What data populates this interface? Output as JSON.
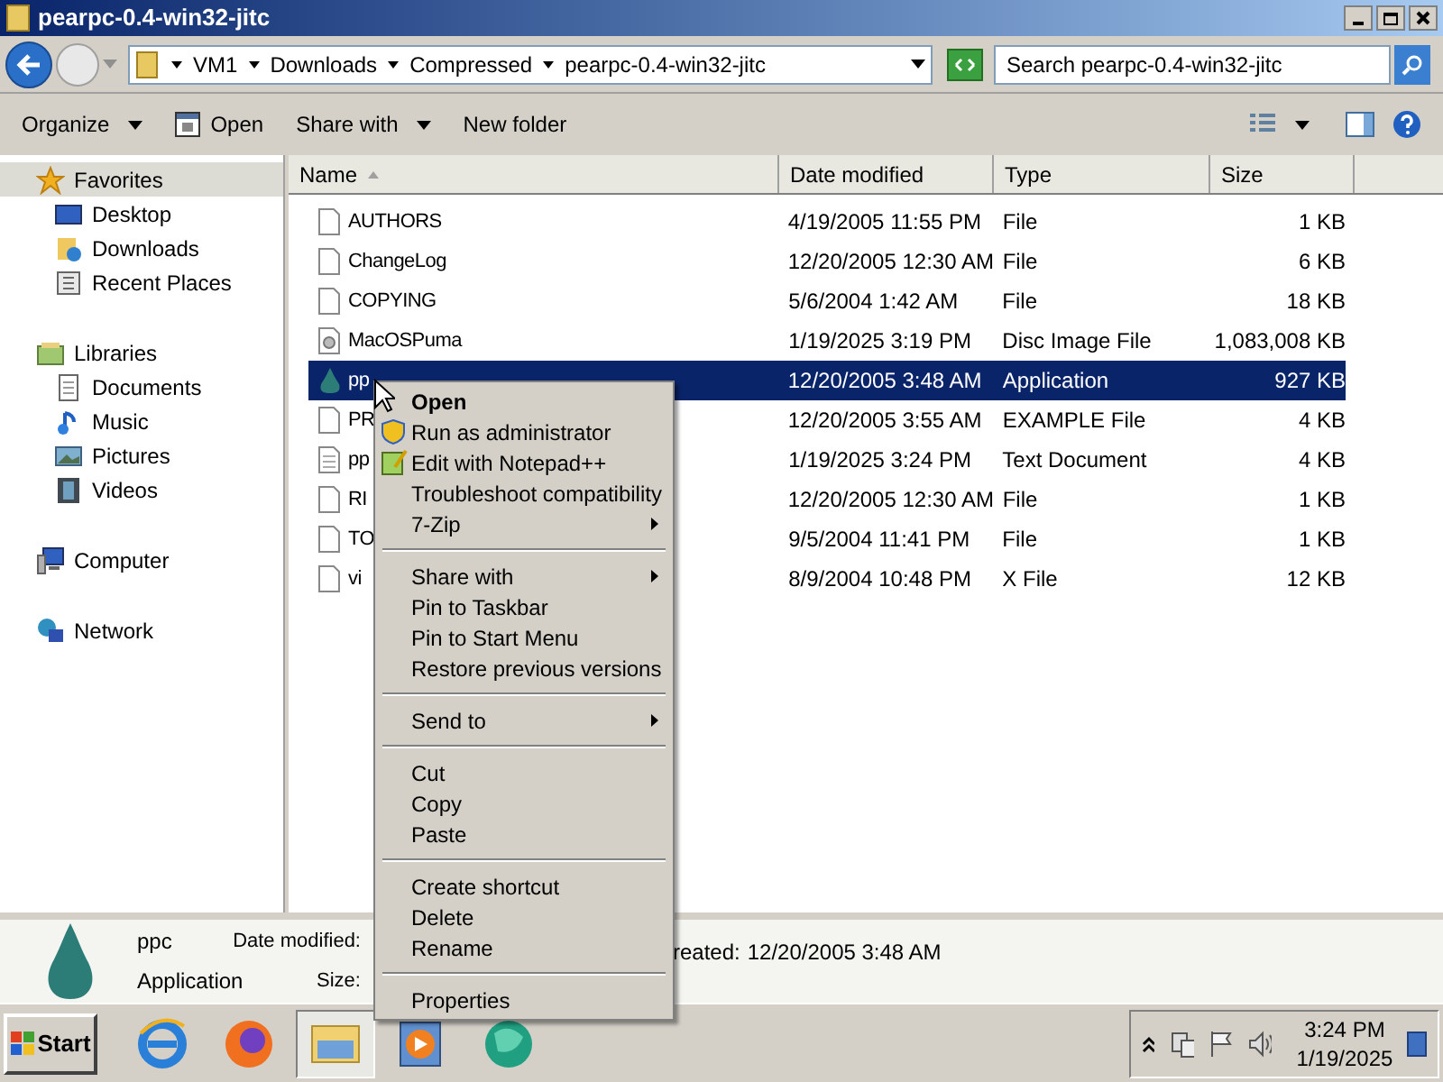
{
  "window": {
    "title": "pearpc-0.4-win32-jitc"
  },
  "address": {
    "breadcrumb": [
      "VM1",
      "Downloads",
      "Compressed",
      "pearpc-0.4-win32-jitc"
    ],
    "search_placeholder": "Search pearpc-0.4-win32-jitc"
  },
  "toolbar": [
    {
      "label": "Organize",
      "kind": "menu"
    },
    {
      "label": "Open",
      "kind": "open"
    },
    {
      "label": "Share with",
      "kind": "menu"
    },
    {
      "label": "New folder",
      "kind": "plain"
    }
  ],
  "sidebar": [
    {
      "label": "Favorites",
      "kind": "star",
      "selected": true,
      "children": [
        {
          "label": "Desktop",
          "kind": "desktop",
          "selected": false
        },
        {
          "label": "Downloads",
          "kind": "downloads",
          "selected": false
        },
        {
          "label": "Recent Places",
          "kind": "recent",
          "selected": false
        }
      ]
    },
    {
      "label": "Libraries",
      "kind": "library",
      "selected": false,
      "children": [
        {
          "label": "Documents",
          "kind": "documents",
          "selected": false
        },
        {
          "label": "Music",
          "kind": "music",
          "selected": false
        },
        {
          "label": "Pictures",
          "kind": "pictures",
          "selected": false
        },
        {
          "label": "Videos",
          "kind": "videos",
          "selected": false
        }
      ]
    },
    {
      "label": "Computer",
      "kind": "computer",
      "selected": false
    },
    {
      "label": "Network",
      "kind": "network",
      "selected": false
    }
  ],
  "table": {
    "columns": [
      "Name",
      "Date modified",
      "Type",
      "Size"
    ],
    "rows": [
      {
        "kind": "file",
        "name": "AUTHORS",
        "date": "4/19/2005 11:55 PM",
        "type": "File",
        "size": "1 KB",
        "selected": false
      },
      {
        "kind": "file",
        "name": "ChangeLog",
        "date": "12/20/2005 12:30 AM",
        "type": "File",
        "size": "6 KB",
        "selected": false
      },
      {
        "kind": "file",
        "name": "COPYING",
        "date": "5/6/2004 1:42 AM",
        "type": "File",
        "size": "18 KB",
        "selected": false
      },
      {
        "kind": "disc",
        "name": "MacOSPuma",
        "date": "1/19/2025 3:19 PM",
        "type": "Disc Image File",
        "size": "1,083,008 KB",
        "selected": false
      },
      {
        "kind": "app",
        "name": "pp",
        "date": "12/20/2005 3:48 AM",
        "type": "Application",
        "size": "927 KB",
        "selected": true
      },
      {
        "kind": "file",
        "name": "PR",
        "date": "12/20/2005 3:55 AM",
        "type": "EXAMPLE File",
        "size": "4 KB",
        "selected": false
      },
      {
        "kind": "text",
        "name": "pp",
        "date": "1/19/2025 3:24 PM",
        "type": "Text Document",
        "size": "4 KB",
        "selected": false
      },
      {
        "kind": "file",
        "name": "RI",
        "date": "12/20/2005 12:30 AM",
        "type": "File",
        "size": "1 KB",
        "selected": false
      },
      {
        "kind": "file",
        "name": "TO",
        "date": "9/5/2004 11:41 PM",
        "type": "File",
        "size": "1 KB",
        "selected": false
      },
      {
        "kind": "file",
        "name": "vi",
        "date": "8/9/2004 10:48 PM",
        "type": "X File",
        "size": "12 KB",
        "selected": false
      }
    ]
  },
  "context_menu": [
    {
      "kind": "default",
      "label": "Open"
    },
    {
      "kind": "shield",
      "label": "Run as administrator"
    },
    {
      "kind": "notepad",
      "label": "Edit with Notepad++"
    },
    {
      "kind": "item",
      "label": "Troubleshoot compatibility"
    },
    {
      "kind": "submenu",
      "label": "7-Zip"
    },
    {
      "kind": "separator"
    },
    {
      "kind": "submenu",
      "label": "Share with"
    },
    {
      "kind": "item",
      "label": "Pin to Taskbar"
    },
    {
      "kind": "item",
      "label": "Pin to Start Menu"
    },
    {
      "kind": "item",
      "label": "Restore previous versions"
    },
    {
      "kind": "separator"
    },
    {
      "kind": "submenu",
      "label": "Send to"
    },
    {
      "kind": "separator"
    },
    {
      "kind": "item",
      "label": "Cut"
    },
    {
      "kind": "item",
      "label": "Copy"
    },
    {
      "kind": "item",
      "label": "Paste"
    },
    {
      "kind": "separator"
    },
    {
      "kind": "item",
      "label": "Create shortcut"
    },
    {
      "kind": "item",
      "label": "Delete"
    },
    {
      "kind": "item",
      "label": "Rename"
    },
    {
      "kind": "separator"
    },
    {
      "kind": "item",
      "label": "Properties"
    }
  ],
  "details": {
    "name": "ppc",
    "type": "Application",
    "date_label": "Date modified:",
    "size_label": "Size:",
    "created_label": "reated:",
    "created_value": "12/20/2005 3:48 AM"
  },
  "taskbar": {
    "start": "Start",
    "apps": [
      {
        "kind": "ie",
        "selected": false
      },
      {
        "kind": "firefox",
        "selected": false
      },
      {
        "kind": "explorer",
        "selected": true
      },
      {
        "kind": "media",
        "selected": false
      },
      {
        "kind": "globe",
        "selected": false
      }
    ],
    "time": "3:24 PM",
    "date": "1/19/2025"
  }
}
